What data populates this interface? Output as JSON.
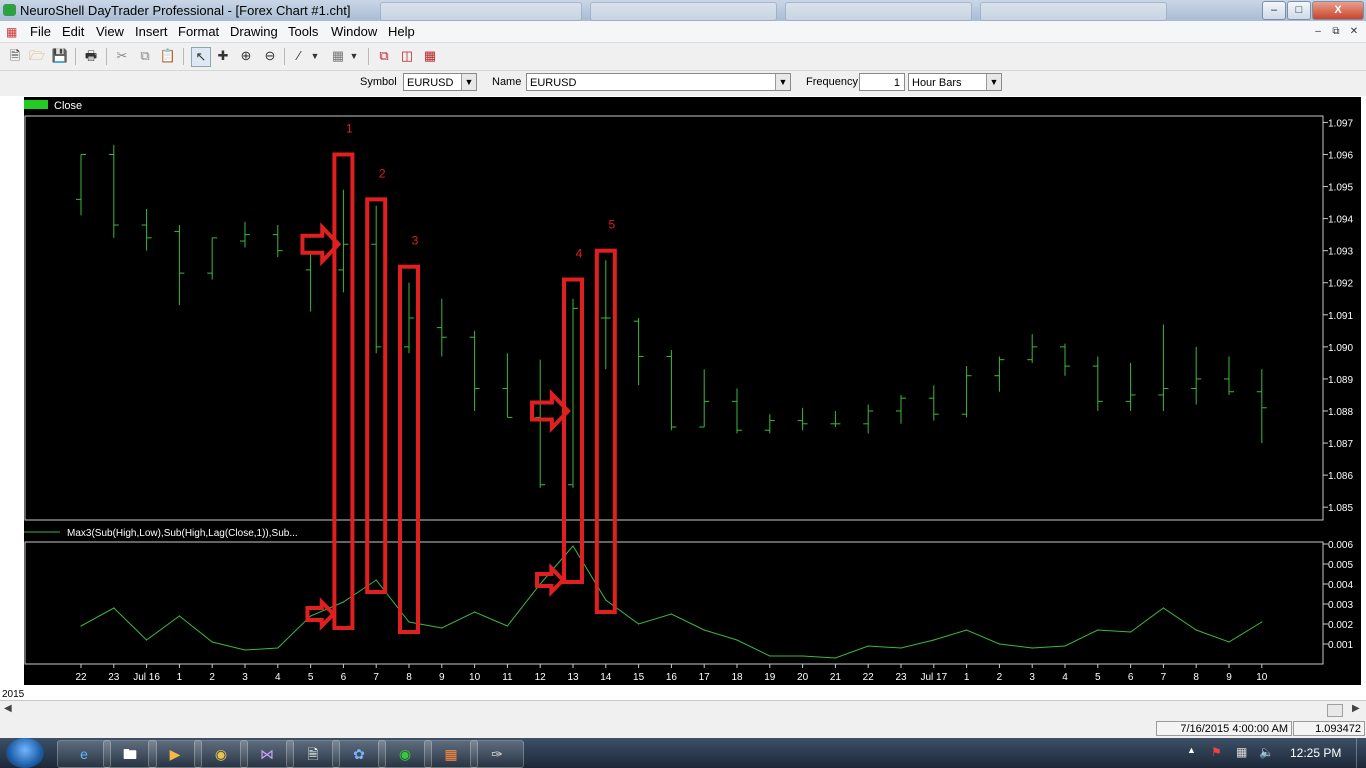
{
  "window": {
    "title": "NeuroShell DayTrader Professional - [Forex Chart #1.cht]"
  },
  "menu": [
    "File",
    "Edit",
    "View",
    "Insert",
    "Format",
    "Drawing",
    "Tools",
    "Window",
    "Help"
  ],
  "toolbar": {
    "icons": [
      "new-file-icon",
      "open-folder-icon",
      "save-icon",
      "print-icon",
      "cut-icon",
      "copy-icon",
      "paste-icon",
      "pointer-icon",
      "crosshair-icon",
      "zoom-in-icon",
      "zoom-out-icon",
      "line-tool-icon",
      "fill-pattern-icon",
      "indicator-icon",
      "chart-window-icon",
      "optimizer-icon"
    ]
  },
  "symbol_bar": {
    "symbol_label": "Symbol",
    "symbol_value": "EURUSD",
    "name_label": "Name",
    "name_value": "EURUSD",
    "frequency_label": "Frequency",
    "frequency_value": "1",
    "bars_value": "Hour Bars"
  },
  "chart_data": {
    "type": "ohlc",
    "legend": "Close",
    "legend_color": "#22cc22",
    "bar_color": "#3cb83c",
    "background": "#000000",
    "x_tick_labels": [
      "22",
      "23",
      "Jul 16",
      "1",
      "2",
      "3",
      "4",
      "5",
      "6",
      "7",
      "8",
      "9",
      "10",
      "11",
      "12",
      "13",
      "14",
      "15",
      "16",
      "17",
      "18",
      "19",
      "20",
      "21",
      "22",
      "23",
      "Jul 17",
      "1",
      "2",
      "3",
      "4",
      "5",
      "6",
      "7",
      "8",
      "9",
      "10"
    ],
    "x_axis_year": "2015",
    "y_ticks": [
      "1.097",
      "1.096",
      "1.095",
      "1.094",
      "1.093",
      "1.092",
      "1.091",
      "1.090",
      "1.089",
      "1.088",
      "1.087",
      "1.086",
      "1.085"
    ],
    "ylim": [
      1.0846,
      1.0972
    ],
    "bars": [
      {
        "high": 1.096,
        "low": 1.0941,
        "open": 1.0946,
        "close": 1.096
      },
      {
        "high": 1.0963,
        "low": 1.0934,
        "open": 1.096,
        "close": 1.0938
      },
      {
        "high": 1.0943,
        "low": 1.093,
        "open": 1.0938,
        "close": 1.0934
      },
      {
        "high": 1.0938,
        "low": 1.0913,
        "open": 1.0936,
        "close": 1.0923
      },
      {
        "high": 1.0934,
        "low": 1.0921,
        "open": 1.0923,
        "close": 1.0934
      },
      {
        "high": 1.0939,
        "low": 1.0931,
        "open": 1.0933,
        "close": 1.0935
      },
      {
        "high": 1.0938,
        "low": 1.0928,
        "open": 1.0935,
        "close": 1.093
      },
      {
        "high": 1.093,
        "low": 1.0911,
        "open": 1.0924,
        "close": 1.0929
      },
      {
        "high": 1.0949,
        "low": 1.0917,
        "open": 1.0924,
        "close": 1.0932
      },
      {
        "high": 1.0944,
        "low": 1.0898,
        "open": 1.0932,
        "close": 1.09
      },
      {
        "high": 1.092,
        "low": 1.0898,
        "open": 1.09,
        "close": 1.0909
      },
      {
        "high": 1.0915,
        "low": 1.0897,
        "open": 1.0906,
        "close": 1.0903
      },
      {
        "high": 1.0905,
        "low": 1.088,
        "open": 1.0903,
        "close": 1.0887
      },
      {
        "high": 1.0898,
        "low": 1.0878,
        "open": 1.0887,
        "close": 1.0878
      },
      {
        "high": 1.0896,
        "low": 1.0856,
        "open": 1.0878,
        "close": 1.0857
      },
      {
        "high": 1.0915,
        "low": 1.0856,
        "open": 1.0857,
        "close": 1.0912
      },
      {
        "high": 1.0927,
        "low": 1.0893,
        "open": 1.0909,
        "close": 1.0909
      },
      {
        "high": 1.0909,
        "low": 1.0888,
        "open": 1.0908,
        "close": 1.0897
      },
      {
        "high": 1.0899,
        "low": 1.0874,
        "open": 1.0897,
        "close": 1.0875
      },
      {
        "high": 1.0893,
        "low": 1.0875,
        "open": 1.0875,
        "close": 1.0883
      },
      {
        "high": 1.0887,
        "low": 1.0873,
        "open": 1.0883,
        "close": 1.0874
      },
      {
        "high": 1.0879,
        "low": 1.0873,
        "open": 1.0874,
        "close": 1.0877
      },
      {
        "high": 1.0881,
        "low": 1.0874,
        "open": 1.0877,
        "close": 1.0876
      },
      {
        "high": 1.088,
        "low": 1.0875,
        "open": 1.0876,
        "close": 1.0876
      },
      {
        "high": 1.0882,
        "low": 1.0873,
        "open": 1.0876,
        "close": 1.088
      },
      {
        "high": 1.0885,
        "low": 1.0876,
        "open": 1.088,
        "close": 1.0884
      },
      {
        "high": 1.0888,
        "low": 1.0877,
        "open": 1.0884,
        "close": 1.0879
      },
      {
        "high": 1.0894,
        "low": 1.0878,
        "open": 1.0879,
        "close": 1.0891
      },
      {
        "high": 1.0897,
        "low": 1.0886,
        "open": 1.0891,
        "close": 1.0896
      },
      {
        "high": 1.0904,
        "low": 1.0895,
        "open": 1.0896,
        "close": 1.09
      },
      {
        "high": 1.0901,
        "low": 1.0891,
        "open": 1.09,
        "close": 1.0894
      },
      {
        "high": 1.0897,
        "low": 1.088,
        "open": 1.0894,
        "close": 1.0883
      },
      {
        "high": 1.0895,
        "low": 1.088,
        "open": 1.0883,
        "close": 1.0885
      },
      {
        "high": 1.0907,
        "low": 1.088,
        "open": 1.0885,
        "close": 1.0887
      },
      {
        "high": 1.09,
        "low": 1.0882,
        "open": 1.0887,
        "close": 1.089
      },
      {
        "high": 1.0897,
        "low": 1.0885,
        "open": 1.089,
        "close": 1.0886
      },
      {
        "high": 1.0893,
        "low": 1.087,
        "open": 1.0886,
        "close": 1.0881
      }
    ],
    "indicator": {
      "legend": "Max3(Sub(High,Low),Sub(High,Lag(Close,1)),Sub...",
      "color": "#3cb83c",
      "y_ticks": [
        "0.006",
        "0.005",
        "0.004",
        "0.003",
        "0.002",
        "0.001"
      ],
      "ylim": [
        0.0,
        0.0061
      ],
      "values": [
        0.0019,
        0.0028,
        0.0012,
        0.0024,
        0.0011,
        0.0007,
        0.0008,
        0.0024,
        0.0031,
        0.0042,
        0.0021,
        0.0018,
        0.0026,
        0.0019,
        0.004,
        0.0059,
        0.0032,
        0.002,
        0.0025,
        0.0017,
        0.0012,
        0.0004,
        0.0004,
        0.0003,
        0.0009,
        0.0008,
        0.0012,
        0.0017,
        0.001,
        0.0008,
        0.0009,
        0.0017,
        0.0016,
        0.0028,
        0.0017,
        0.0011,
        0.0021
      ]
    },
    "annotations": {
      "color": "#e02020",
      "rect_labels": [
        "1",
        "2",
        "3",
        "4",
        "5"
      ],
      "rect_bar_index": [
        8,
        9,
        10,
        15,
        16
      ],
      "rect_price_top": [
        1.096,
        1.0946,
        1.0925,
        1.0921,
        1.093
      ],
      "arrows": [
        {
          "bar": 7.3,
          "price": 1.0932
        },
        {
          "bar": 14.3,
          "price": 1.088
        },
        {
          "bar": 7.3,
          "ind": 0.0025
        },
        {
          "bar": 14.3,
          "ind": 0.0042
        }
      ]
    }
  },
  "status_bar": {
    "datetime": "7/16/2015 4:00:00 AM",
    "value": "1.093472"
  },
  "taskbar": {
    "apps": [
      "internet-explorer-icon",
      "folder-icon",
      "media-player-icon",
      "chrome-icon",
      "visual-studio-icon",
      "notepad-icon",
      "network-icon",
      "neuroshell-icon",
      "xampp-icon",
      "paint-icon"
    ],
    "clock": "12:25 PM"
  }
}
